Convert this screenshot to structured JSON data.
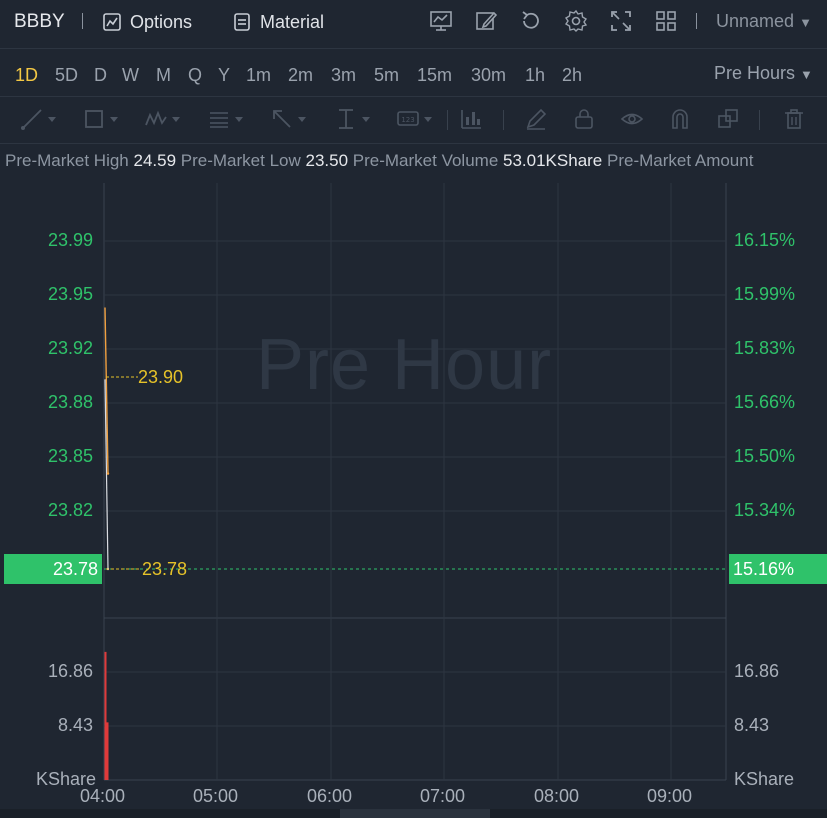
{
  "topbar": {
    "symbol": "BBBY",
    "options_label": "Options",
    "material_label": "Material",
    "layout_name": "Unnamed",
    "icons": [
      "chart-indicator-icon",
      "edit-icon",
      "refresh-icon",
      "settings-icon",
      "fullscreen-icon",
      "grid-layout-icon"
    ]
  },
  "periods": {
    "items": [
      "1D",
      "5D",
      "D",
      "W",
      "M",
      "Q",
      "Y",
      "1m",
      "2m",
      "3m",
      "5m",
      "15m",
      "30m",
      "1h",
      "2h"
    ],
    "active": "1D",
    "session": "Pre Hours"
  },
  "draw_tools": [
    "line-tool-icon",
    "rectangle-tool-icon",
    "wave-tool-icon",
    "fib-tool-icon",
    "arrow-tool-icon",
    "measure-tool-icon",
    "text-label-tool-icon",
    "indicator-tool-icon",
    "pen-tool-icon",
    "lock-icon",
    "eye-icon",
    "magnet-icon",
    "copy-icon",
    "trash-icon"
  ],
  "info": {
    "high_label": "Pre-Market High",
    "high_value": "24.59",
    "low_label": "Pre-Market Low",
    "low_value": "23.50",
    "volume_label": "Pre-Market Volume",
    "volume_value": "53.01KShare",
    "amount_label": "Pre-Market Amount"
  },
  "chart": {
    "watermark": "Pre Hour",
    "price_ticks_left": [
      "23.99",
      "23.95",
      "23.92",
      "23.88",
      "23.85",
      "23.82"
    ],
    "price_ticks_right": [
      "16.15%",
      "15.99%",
      "15.83%",
      "15.66%",
      "15.50%",
      "15.34%"
    ],
    "current_price": "23.78",
    "current_pct": "15.16%",
    "annotation_high": "23.90",
    "annotation_current": "23.78",
    "volume_ticks_left": [
      "16.86",
      "8.43"
    ],
    "volume_ticks_right": [
      "16.86",
      "8.43"
    ],
    "volume_unit_left": "KShare",
    "volume_unit_right": "KShare",
    "time_ticks": [
      "04:00",
      "05:00",
      "06:00",
      "07:00",
      "08:00",
      "09:00"
    ],
    "colors": {
      "up": "#2fc26a",
      "down": "#e03a3a",
      "price_line_1": "#f0a040",
      "price_line_2": "#d9dce1",
      "dash": "#e6c229"
    }
  },
  "chart_data": {
    "type": "line",
    "xlabel": "",
    "ylabel": "",
    "x": [
      "04:00",
      "04:01",
      "04:02"
    ],
    "series": [
      {
        "values": [
          23.95,
          23.85,
          23.78
        ]
      }
    ],
    "ylim": [
      23.78,
      23.99
    ],
    "volume": {
      "unit": "KShare",
      "ylim": [
        0,
        16.86
      ],
      "values": [
        20.0,
        9.0
      ]
    }
  }
}
